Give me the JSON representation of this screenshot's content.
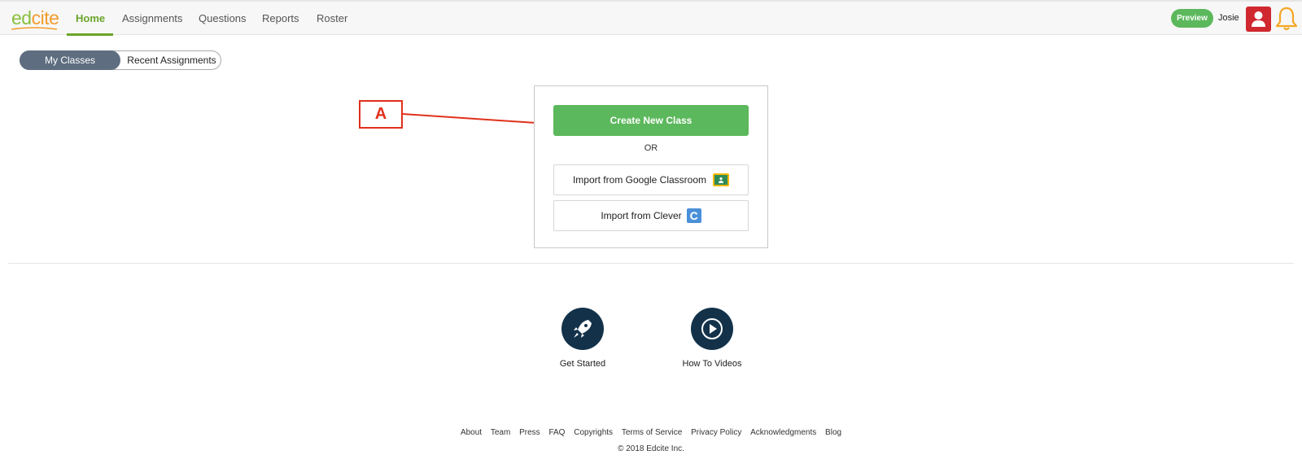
{
  "header": {
    "logo": {
      "ed": "ed",
      "cite": "cite"
    },
    "nav": [
      {
        "label": "Home",
        "active": true
      },
      {
        "label": "Assignments"
      },
      {
        "label": "Questions"
      },
      {
        "label": "Reports"
      },
      {
        "label": "Roster"
      }
    ],
    "preview_label": "Preview",
    "user_name": "Josie",
    "avatar_icon": "user-icon",
    "notification_icon": "bell-icon",
    "colors": {
      "brand_green": "#6aa52a",
      "brand_orange": "#f39c2b",
      "avatar_red": "#d0282f",
      "bell_orange": "#f5a623"
    }
  },
  "toggle": {
    "selected": "My Classes",
    "other": "Recent Assignments"
  },
  "annotation": {
    "label": "A",
    "color": "#e0311b"
  },
  "class_card": {
    "create_label": "Create New Class",
    "or_label": "OR",
    "google_label": "Import from Google Classroom",
    "google_icon": "google-classroom-icon",
    "clever_label": "Import from Clever",
    "clever_icon": "clever-icon",
    "clever_letter": "C",
    "button_green": "#5cb85c"
  },
  "resources": [
    {
      "label": "Get Started",
      "icon": "rocket-icon"
    },
    {
      "label": "How To Videos",
      "icon": "play-icon"
    }
  ],
  "footer": {
    "links": [
      "About",
      "Team",
      "Press",
      "FAQ",
      "Copyrights",
      "Terms of Service",
      "Privacy Policy",
      "Acknowledgments",
      "Blog"
    ],
    "copyright": "© 2018 Edcite Inc."
  }
}
